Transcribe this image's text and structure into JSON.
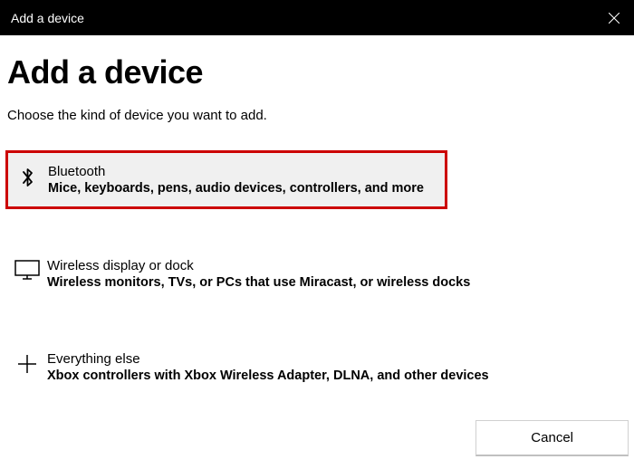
{
  "titlebar": {
    "title": "Add a device"
  },
  "heading": "Add a device",
  "subtitle": "Choose the kind of device you want to add.",
  "options": {
    "bluetooth": {
      "title": "Bluetooth",
      "desc": "Mice, keyboards, pens, audio devices, controllers, and more"
    },
    "wireless": {
      "title": "Wireless display or dock",
      "desc": "Wireless monitors, TVs, or PCs that use Miracast, or wireless docks"
    },
    "everything": {
      "title": "Everything else",
      "desc": "Xbox controllers with Xbox Wireless Adapter, DLNA, and other devices"
    }
  },
  "footer": {
    "cancel": "Cancel"
  }
}
